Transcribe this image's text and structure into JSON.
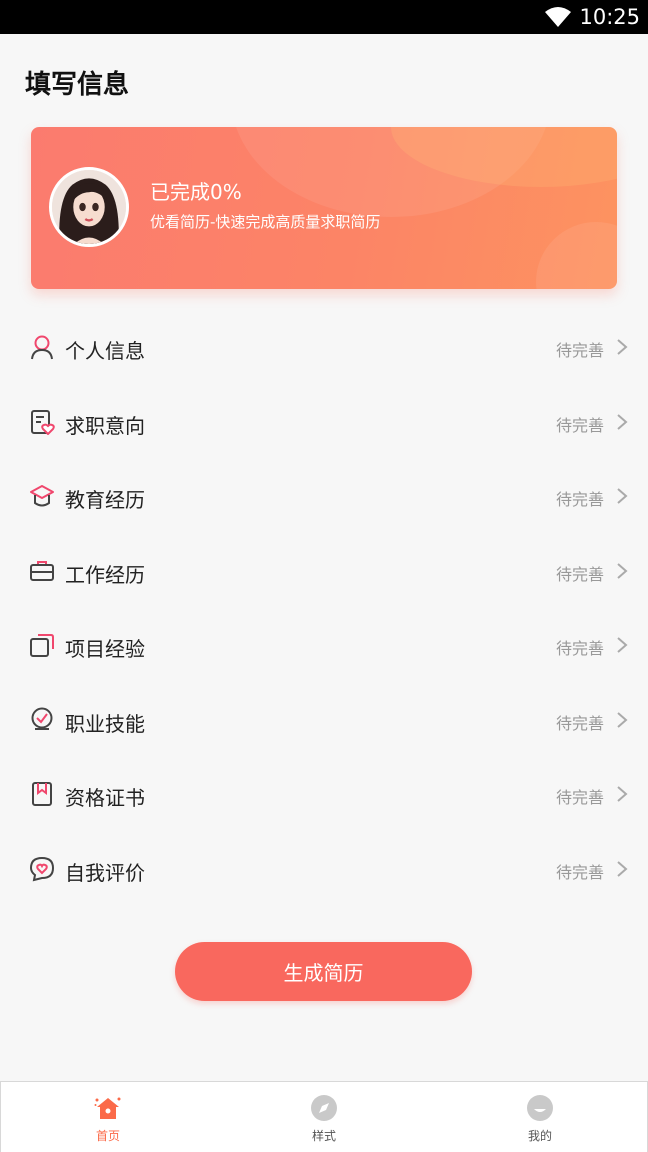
{
  "status_bar": {
    "time": "10:25"
  },
  "page": {
    "title": "填写信息"
  },
  "banner": {
    "progress_text": "已完成0%",
    "subtitle": "优看简历-快速完成高质量求职简历"
  },
  "menu": {
    "items": [
      {
        "label": "个人信息",
        "status": "待完善",
        "icon": "person-icon"
      },
      {
        "label": "求职意向",
        "status": "待完善",
        "icon": "intent-heart-icon"
      },
      {
        "label": "教育经历",
        "status": "待完善",
        "icon": "graduation-cap-icon"
      },
      {
        "label": "工作经历",
        "status": "待完善",
        "icon": "briefcase-icon"
      },
      {
        "label": "项目经验",
        "status": "待完善",
        "icon": "project-icon"
      },
      {
        "label": "职业技能",
        "status": "待完善",
        "icon": "skill-check-icon"
      },
      {
        "label": "资格证书",
        "status": "待完善",
        "icon": "certificate-icon"
      },
      {
        "label": "自我评价",
        "status": "待完善",
        "icon": "heart-chat-icon"
      }
    ]
  },
  "actions": {
    "generate_label": "生成简历"
  },
  "tabbar": {
    "items": [
      {
        "label": "首页",
        "icon": "home-icon",
        "active": true
      },
      {
        "label": "样式",
        "icon": "compass-icon",
        "active": false
      },
      {
        "label": "我的",
        "icon": "profile-icon",
        "active": false
      }
    ]
  },
  "colors": {
    "accent": "#f9685e",
    "icon_pink": "#f0476d",
    "tab_active": "#fb6a49"
  }
}
